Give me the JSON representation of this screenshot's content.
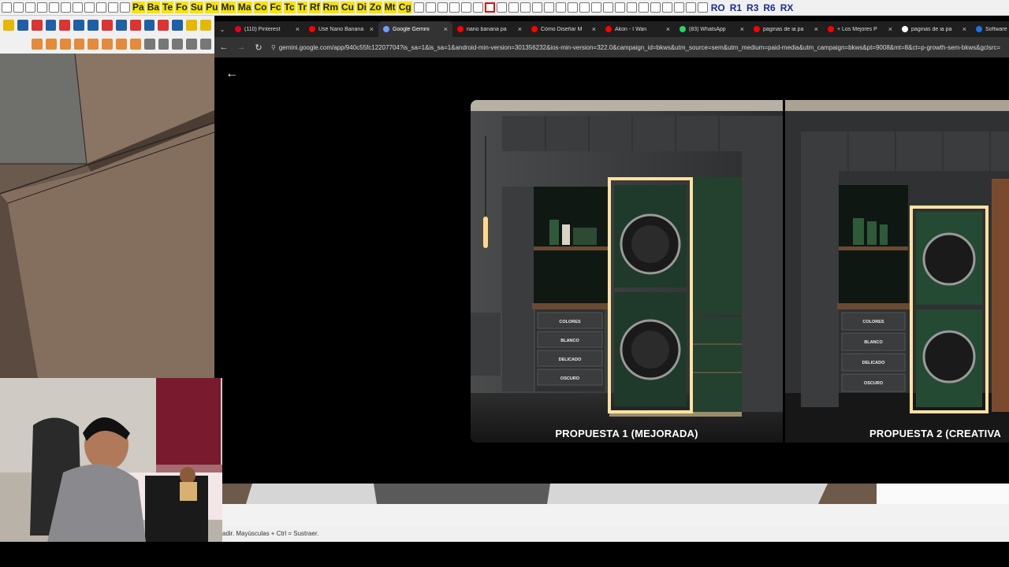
{
  "sketchup": {
    "toolbar_labels": [
      "Pa",
      "Ba",
      "Te",
      "Fo",
      "Su",
      "Pu",
      "Mn",
      "Ma",
      "Co",
      "Fc",
      "Tc",
      "Tr",
      "Rf",
      "Rm",
      "Cu",
      "Di",
      "Zo",
      "Mt",
      "Cg"
    ],
    "right_labels": [
      "RO",
      "R1",
      "R3",
      "R6",
      "RX"
    ],
    "status_text": "adir. Mayúsculas + Ctrl = Sustraer."
  },
  "browser": {
    "tabs": [
      {
        "label": "(110) Pinterest",
        "icon": "pinterest-icon",
        "color": "#e60023",
        "active": false
      },
      {
        "label": "Usé Nano Banana",
        "icon": "youtube-icon",
        "color": "#ff0000",
        "active": false
      },
      {
        "label": "Google Gemini",
        "icon": "gemini-icon",
        "color": "#6aa0ff",
        "active": true
      },
      {
        "label": "nano banana pa",
        "icon": "youtube-icon",
        "color": "#ff0000",
        "active": false
      },
      {
        "label": "Cómo Diseñar M",
        "icon": "youtube-icon",
        "color": "#ff0000",
        "active": false
      },
      {
        "label": "Akon - I Wan",
        "icon": "youtube-icon",
        "color": "#ff0000",
        "active": false
      },
      {
        "label": "(83) WhatsApp",
        "icon": "whatsapp-icon",
        "color": "#25d366",
        "active": false
      },
      {
        "label": "paginas de ia pa",
        "icon": "youtube-icon",
        "color": "#ff0000",
        "active": false
      },
      {
        "label": "+ Los Mejores P",
        "icon": "youtube-icon",
        "color": "#ff0000",
        "active": false
      },
      {
        "label": "paginas de ia pa",
        "icon": "google-icon",
        "color": "#ffffff",
        "active": false
      },
      {
        "label": "Software gra",
        "icon": "site-icon",
        "color": "#1a73e8",
        "active": false
      }
    ],
    "url": "gemini.google.com/app/940c55fc12207704?is_sa=1&is_sa=1&android-min-version=301356232&ios-min-version=322.0&campaign_id=bkws&utm_source=sem&utm_medium=paid-media&utm_campaign=bkws&pt=9008&mt=8&ct=p-growth-sem-bkws&gclsrc="
  },
  "viewer": {
    "images": [
      {
        "caption": "PROPUESTA 1 (MEJORADA)",
        "drawer_labels": [
          "COLORES",
          "BLANCO",
          "DELICADO",
          "OSCURO"
        ]
      },
      {
        "caption": "PROPUESTA 2 (CREATIVA",
        "drawer_labels": [
          "COLORES",
          "BLANCO",
          "DELICADO",
          "OSCURO"
        ]
      }
    ]
  },
  "colors": {
    "cabinet": "#3a3c3d",
    "green": "#1f3a2a",
    "glow": "#ffe7a8"
  }
}
